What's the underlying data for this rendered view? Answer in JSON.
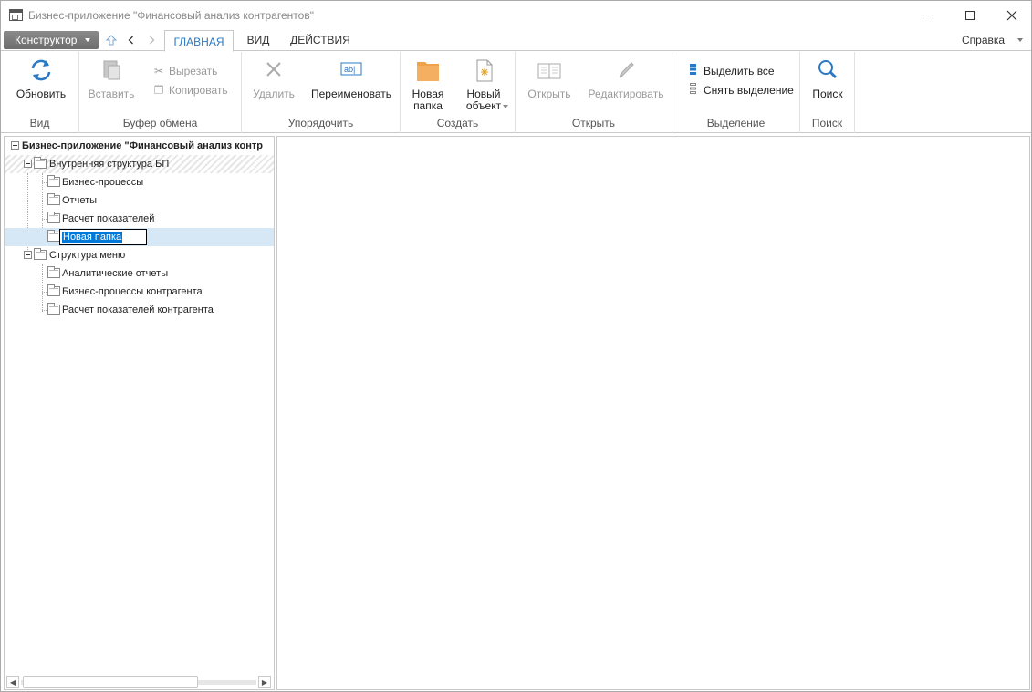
{
  "window": {
    "title": "Бизнес-приложение \"Финансовый анализ контрагентов\""
  },
  "tabs": {
    "constructor": "Конструктор",
    "home": "ГЛАВНАЯ",
    "view": "ВИД",
    "actions": "ДЕЙСТВИЯ",
    "help": "Справка"
  },
  "ribbon": {
    "groups": {
      "view": "Вид",
      "clipboard": "Буфер обмена",
      "organize": "Упорядочить",
      "create": "Создать",
      "open": "Открыть",
      "selection": "Выделение",
      "search": "Поиск"
    },
    "buttons": {
      "refresh": "Обновить",
      "paste": "Вставить",
      "cut": "Вырезать",
      "copy": "Копировать",
      "delete": "Удалить",
      "rename": "Переименовать",
      "new_folder_1": "Новая",
      "new_folder_2": "папка",
      "new_object_1": "Новый",
      "new_object_2": "объект",
      "open": "Открыть",
      "edit": "Редактировать",
      "select_all": "Выделить все",
      "deselect": "Снять выделение",
      "search": "Поиск"
    },
    "colors": {
      "accent": "#2b79c4",
      "folder": "#f0a24a"
    }
  },
  "tree": {
    "root": "Бизнес-приложение \"Финансовый анализ контр",
    "nodes": [
      {
        "label": "Внутренняя структура БП"
      },
      {
        "label": "Бизнес-процессы"
      },
      {
        "label": "Отчеты"
      },
      {
        "label": "Расчет показателей"
      },
      {
        "label": "Новая папка"
      },
      {
        "label": "Структура меню"
      },
      {
        "label": "Аналитические отчеты"
      },
      {
        "label": "Бизнес-процессы контрагента"
      },
      {
        "label": "Расчет показателей контрагента"
      }
    ]
  }
}
